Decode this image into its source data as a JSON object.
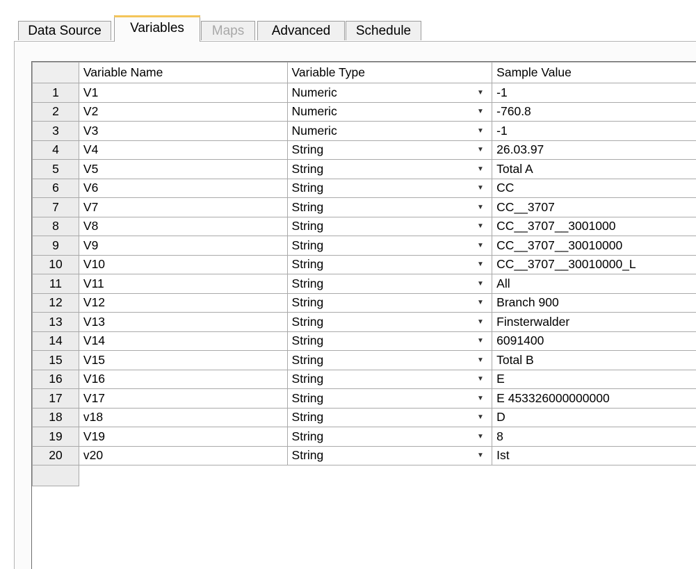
{
  "tabs": [
    {
      "label": "Data Source",
      "active": false,
      "enabled": true
    },
    {
      "label": "Variables",
      "active": true,
      "enabled": true
    },
    {
      "label": "Maps",
      "active": false,
      "enabled": false
    },
    {
      "label": "Advanced",
      "active": false,
      "enabled": true
    },
    {
      "label": "Schedule",
      "active": false,
      "enabled": true
    }
  ],
  "grid": {
    "headers": {
      "name": "Variable Name",
      "type": "Variable Type",
      "sample": "Sample Value"
    },
    "rows": [
      {
        "num": "1",
        "name": "V1",
        "type": "Numeric",
        "sample": "-1"
      },
      {
        "num": "2",
        "name": "V2",
        "type": "Numeric",
        "sample": "-760.8"
      },
      {
        "num": "3",
        "name": "V3",
        "type": "Numeric",
        "sample": "-1"
      },
      {
        "num": "4",
        "name": "V4",
        "type": "String",
        "sample": "26.03.97"
      },
      {
        "num": "5",
        "name": "V5",
        "type": "String",
        "sample": "Total A"
      },
      {
        "num": "6",
        "name": "V6",
        "type": "String",
        "sample": "CC"
      },
      {
        "num": "7",
        "name": "V7",
        "type": "String",
        "sample": "CC__3707"
      },
      {
        "num": "8",
        "name": "V8",
        "type": "String",
        "sample": "CC__3707__3001000"
      },
      {
        "num": "9",
        "name": "V9",
        "type": "String",
        "sample": "CC__3707__30010000"
      },
      {
        "num": "10",
        "name": "V10",
        "type": "String",
        "sample": "CC__3707__30010000_L"
      },
      {
        "num": "11",
        "name": "V11",
        "type": "String",
        "sample": "All"
      },
      {
        "num": "12",
        "name": "V12",
        "type": "String",
        "sample": "Branch 900"
      },
      {
        "num": "13",
        "name": "V13",
        "type": "String",
        "sample": "Finsterwalder"
      },
      {
        "num": "14",
        "name": "V14",
        "type": "String",
        "sample": "6091400"
      },
      {
        "num": "15",
        "name": "V15",
        "type": "String",
        "sample": "Total B"
      },
      {
        "num": "16",
        "name": "V16",
        "type": "String",
        "sample": "E"
      },
      {
        "num": "17",
        "name": "V17",
        "type": "String",
        "sample": "E 453326000000000"
      },
      {
        "num": "18",
        "name": "v18",
        "type": "String",
        "sample": "D"
      },
      {
        "num": "19",
        "name": "V19",
        "type": "String",
        "sample": "8"
      },
      {
        "num": "20",
        "name": "v20",
        "type": "String",
        "sample": "Ist"
      }
    ]
  },
  "icons": {
    "dropdown": "chevron-down-icon"
  }
}
